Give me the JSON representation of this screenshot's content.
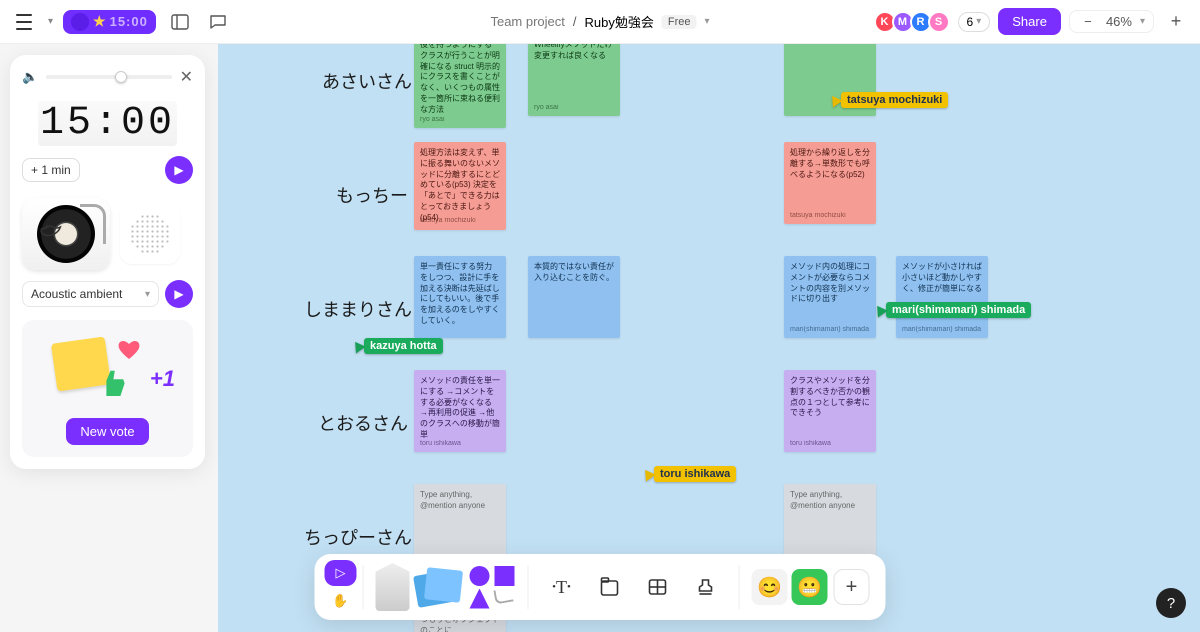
{
  "header": {
    "project": "Team project",
    "sep": "/",
    "file": "Ruby勉強会",
    "plan": "Free",
    "timer_badge": "15:00",
    "zoom": "46%",
    "presence_count": "6",
    "share": "Share",
    "avatars": [
      {
        "initial": "K",
        "color": "#ff4757"
      },
      {
        "initial": "M",
        "color": "#9b59ff"
      },
      {
        "initial": "R",
        "color": "#2d7bff"
      },
      {
        "initial": "S",
        "color": "#ff7ac3"
      }
    ]
  },
  "timer_panel": {
    "big_time": "15:00",
    "add_min": "+  1 min",
    "track": "Acoustic ambient",
    "new_vote": "New vote",
    "plus1": "+1"
  },
  "rows": {
    "r1": "あさいさん",
    "r2": "もっちー",
    "r3": "しままりさん",
    "r4": "とおるさん",
    "r5": "ちっぴーさん"
  },
  "stickies": {
    "a1": {
      "text": "役を持つようにするクラスが行うことが明確になる\nstruct 明示的にクラスを書くことがなく、いくつもの属性を一箇所に束ねる便利な方法",
      "author": "ryo asai"
    },
    "a2": {
      "text": "Wheelifyメソッドだけ変更すれば良くなる",
      "author": "ryo asai"
    },
    "a3": {
      "text": "",
      "author": ""
    },
    "m1": {
      "text": "処理方法は変えず、単に振る舞いのないメソッドに分離するにとどめている(p53) 決定を「あとで」できる力はとっておきましょう(p54)",
      "author": "tatsuya mochizuki"
    },
    "m2": {
      "text": "処理から繰り返しを分離する→単数形でも呼べるようになる(p52)",
      "author": "tatsuya mochizuki"
    },
    "s1": {
      "text": "単一責任にする努力をしつつ、設計に手を加える決断は先延ばしにしてもいい。後で手を加えるのをしやすくしていく。",
      "author": ""
    },
    "s2": {
      "text": "本質的ではない責任が入り込むことを防ぐ。",
      "author": ""
    },
    "s3": {
      "text": "メソッド内の処理にコメントが必要ならコメントの内容を別メソッドに切り出す",
      "author": "mari(shimamari) shimada"
    },
    "s4": {
      "text": "メソッドが小さければ小さいほど動かしやすく、修正が簡単になる",
      "author": "mari(shimamari) shimada"
    },
    "t1": {
      "text": "メソッドの責任を単一にする\n→コメントをする必要がなくなる\n→再利用の促進\n→他のクラスへの移動が簡単",
      "author": "toru ishikawa"
    },
    "t2": {
      "text": "クラスやメソッドを分割するべきか否かの観点の１つとして参考にできそう",
      "author": "toru ishikawa"
    },
    "g1": {
      "text": "Type anything, @mention anyone",
      "author": ""
    },
    "g2": {
      "text": "Type anything, @mention anyone",
      "author": ""
    },
    "c1": {
      "text": "に。細分の設定までをつもりとオブジェクトのことに",
      "author": ""
    }
  },
  "cursors": {
    "c_mochi": "tatsuya mochizuki",
    "c_hotta": "kazuya hotta",
    "c_shima": "mari(shimamari) shimada",
    "c_toru": "toru ishikawa"
  },
  "toolbar": {
    "text_tool": "T"
  }
}
